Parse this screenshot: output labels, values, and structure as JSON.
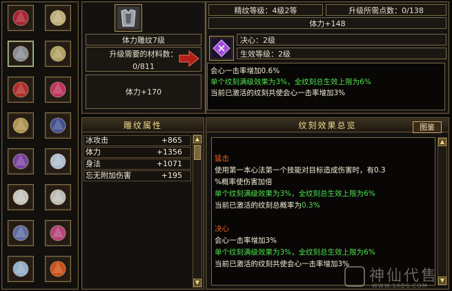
{
  "equipment": [
    {
      "name": "gem-chain-icon",
      "color": "#c0243a"
    },
    {
      "name": "ring-icon",
      "color": "#d8c88a"
    },
    {
      "name": "armor-icon",
      "color": "#9aa0a8"
    },
    {
      "name": "ring-icon",
      "color": "#c8b870"
    },
    {
      "name": "bracer-icon",
      "color": "#c8302a"
    },
    {
      "name": "bracelet-icon",
      "color": "#d83a6a"
    },
    {
      "name": "belt-icon",
      "color": "#c8a85a"
    },
    {
      "name": "boots-icon",
      "color": "#4a5aa8"
    },
    {
      "name": "amulet-icon",
      "color": "#8a4ab8"
    },
    {
      "name": "blade-icon",
      "color": "#c8d8f0"
    },
    {
      "name": "mask-icon",
      "color": "#e0e0d8"
    },
    {
      "name": "mask-icon",
      "color": "#d8d8d0"
    },
    {
      "name": "glove-icon",
      "color": "#6a7ab8"
    },
    {
      "name": "necklace-icon",
      "color": "#d04a8a"
    },
    {
      "name": "staff-icon",
      "color": "#a8c8e8"
    },
    {
      "name": "flame-orb-icon",
      "color": "#e85a1a"
    }
  ],
  "carving": {
    "name": "体力雕纹7级",
    "material_label": "升级需要的材料数：",
    "material_value": "0/811",
    "stat": "体力+170"
  },
  "upgrade": {
    "level_label": "精纹等级：4级2等",
    "points_label": "升级所需点数：0/138",
    "attribute": "体力+148",
    "effect_name": "决心：2级",
    "active_level": "生效等级：2级",
    "desc_white": "会心一击率增加0.6%",
    "desc_green": "单个纹刻满级效果为3%，全纹刻总生效上限为6%",
    "desc_white2": "当前已激活的纹刻共使会心一击率增加3%"
  },
  "attributes": {
    "title": "雕纹属性",
    "rows": [
      {
        "name": "冰攻击",
        "value": "+865"
      },
      {
        "name": "体力",
        "value": "+1356"
      },
      {
        "name": "身法",
        "value": "+1071"
      },
      {
        "name": "忘无附加伤害",
        "value": "+195"
      }
    ]
  },
  "overview": {
    "title": "纹刻效果总览",
    "button": "图鉴",
    "sections": [
      {
        "title": "猛击",
        "desc1": "使用第一本心法第一个技能对目标造成伤害时，有0.3",
        "desc2": "%概率使伤害加倍",
        "green": "单个纹刻满级效果为3%，全纹刻总生效上限为6%",
        "current_prefix": "当前已激活的纹刻总概率为",
        "current_value": "0.3%"
      },
      {
        "title": "决心",
        "desc1": "会心一击率增加3%",
        "green": "单个纹刻满级效果为3%，全纹刻总生效上限为6%",
        "current": "当前已激活的纹刻共使会心一击率增加3%"
      }
    ]
  },
  "watermark": {
    "text": "神仙代售",
    "url": "WWW.SXDS.COM"
  }
}
